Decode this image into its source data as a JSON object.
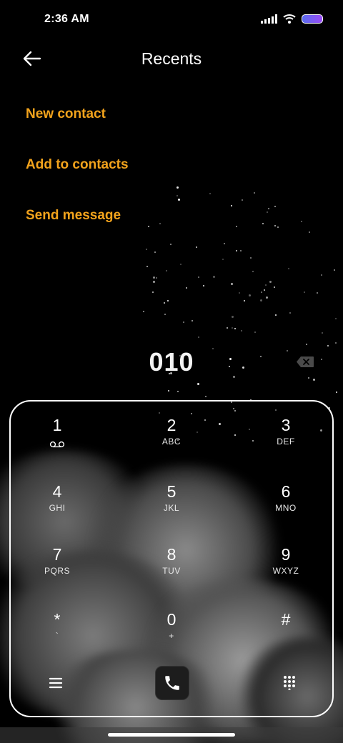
{
  "status_bar": {
    "time": "2:36 AM",
    "icons": [
      "signal-icon",
      "wifi-icon",
      "battery-icon"
    ],
    "battery_color": "#7a5cf3"
  },
  "header": {
    "title": "Recents",
    "back_icon": "back-arrow-icon"
  },
  "actions": [
    {
      "label": "New contact"
    },
    {
      "label": "Add to contacts"
    },
    {
      "label": "Send message"
    }
  ],
  "accent_color": "#f2a31c",
  "dialer": {
    "number": "010",
    "backspace_icon": "backspace-icon",
    "keys": [
      {
        "digit": "1",
        "letters": ""
      },
      {
        "digit": "2",
        "letters": "ABC"
      },
      {
        "digit": "3",
        "letters": "DEF"
      },
      {
        "digit": "4",
        "letters": "GHI"
      },
      {
        "digit": "5",
        "letters": "JKL"
      },
      {
        "digit": "6",
        "letters": "MNO"
      },
      {
        "digit": "7",
        "letters": "PQRS"
      },
      {
        "digit": "8",
        "letters": "TUV"
      },
      {
        "digit": "9",
        "letters": "WXYZ"
      },
      {
        "digit": "*",
        "letters": "`"
      },
      {
        "digit": "0",
        "letters": "+"
      },
      {
        "digit": "#",
        "letters": ""
      }
    ],
    "bottom": {
      "menu_icon": "menu-icon",
      "call_icon": "phone-icon",
      "keypad_icon": "dialpad-icon"
    }
  }
}
